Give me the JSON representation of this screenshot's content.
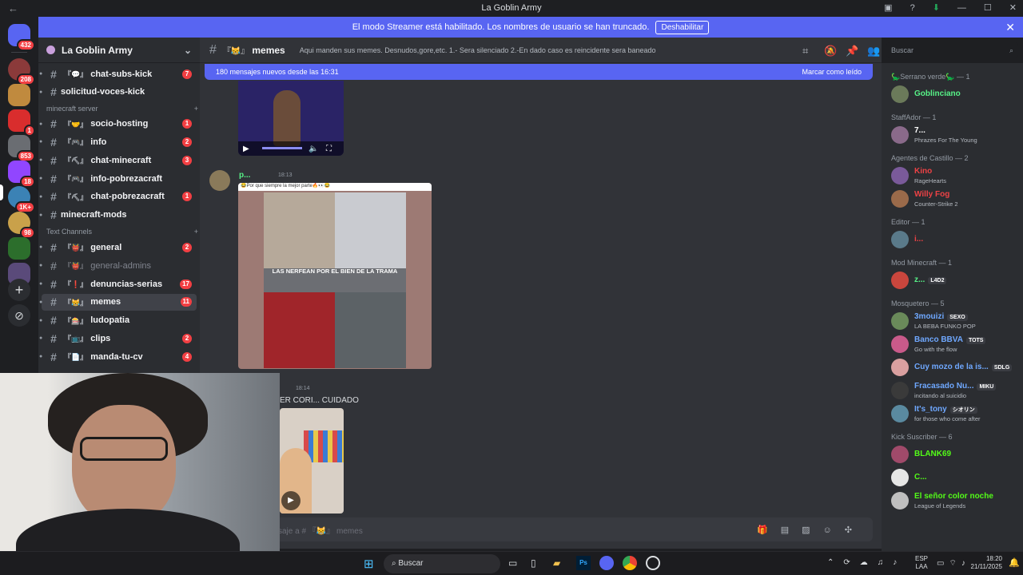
{
  "window": {
    "title": "La Goblin Army",
    "nav_back": "←",
    "nav_fwd": "→"
  },
  "streamer_banner": {
    "text": "El modo Streamer está habilitado. Los nombres de usuario se han truncado.",
    "button": "Deshabilitar"
  },
  "guild_badges": [
    "432",
    "208",
    "1",
    "853",
    "18",
    "1K+",
    "98"
  ],
  "server": {
    "name": "La Goblin Army"
  },
  "channels": {
    "top": [
      {
        "name": "chat-subs-kick",
        "emoji": "『💬』",
        "count": "7"
      },
      {
        "name": "solicitud-voces-kick",
        "emoji": "",
        "count": ""
      }
    ],
    "minecraft_category": "minecraft server",
    "minecraft": [
      {
        "name": "socio-hosting",
        "emoji": "『🤝』",
        "count": "1"
      },
      {
        "name": "info",
        "emoji": "『🎮』",
        "count": "2"
      },
      {
        "name": "chat-minecraft",
        "emoji": "『⛏』",
        "count": "3"
      },
      {
        "name": "info-pobrezacraft",
        "emoji": "『🎮』",
        "count": ""
      },
      {
        "name": "chat-pobrezacraft",
        "emoji": "『⛏』",
        "count": "1"
      },
      {
        "name": "minecraft-mods",
        "emoji": "",
        "count": ""
      }
    ],
    "text_category": "Text Channels",
    "text": [
      {
        "name": "general",
        "emoji": "『👹』",
        "count": "2"
      },
      {
        "name": "general-admins",
        "emoji": "『👹』",
        "count": ""
      },
      {
        "name": "denuncias-serias",
        "emoji": "『❗』",
        "count": "17"
      },
      {
        "name": "memes",
        "emoji": "『😹』",
        "count": "11"
      },
      {
        "name": "ludopatia",
        "emoji": "『🎰』",
        "count": ""
      },
      {
        "name": "clips",
        "emoji": "『📺』",
        "count": "2"
      },
      {
        "name": "manda-tu-cv",
        "emoji": "『📄』",
        "count": "4"
      }
    ]
  },
  "channel_header": {
    "name": "memes",
    "emoji": "『😹』",
    "topic": "Aqui manden sus memes. Desnudos,gore,etc. 1.- Sera silenciado 2.-En dado caso es reincidente sera baneado",
    "search_placeholder": "Buscar"
  },
  "new_messages": {
    "text": "180 mensajes nuevos desde las 16:31",
    "mark_read": "Marcar como leído"
  },
  "messages": [
    {
      "author": "p...",
      "time": "18:13",
      "image_caption": "😂Por que siempre la mejor parte🔥👀😂",
      "meme_text": "LAS NERFEAN POR EL BIEN DE LA TRAMA"
    },
    {
      "author": "",
      "time": "18:14",
      "text": "ER CORI... CUIDADO"
    }
  ],
  "composer": {
    "placeholder": "saje a # 『😹』 memes"
  },
  "members": [
    {
      "category": "🦕Serrano verde🦕 — 1",
      "users": [
        {
          "name": "Goblinciano",
          "status": "",
          "color": "#57f287",
          "tag": ""
        }
      ]
    },
    {
      "category": "StaffAdor — 1",
      "users": [
        {
          "name": "7...",
          "status": "Phrazes For The Young",
          "color": "#ffffff",
          "tag": ""
        }
      ]
    },
    {
      "category": "Agentes de Castillo — 2",
      "users": [
        {
          "name": "Kino",
          "status": "RageHearts",
          "color": "#ed4245",
          "tag": ""
        },
        {
          "name": "Willy Fog",
          "status": "Counter-Strike 2",
          "color": "#ed4245",
          "tag": ""
        }
      ]
    },
    {
      "category": "Editor — 1",
      "users": [
        {
          "name": "i...",
          "status": "",
          "color": "#ed4245",
          "tag": ""
        }
      ]
    },
    {
      "category": "Mod Minecraft — 1",
      "users": [
        {
          "name": "z...",
          "status": "",
          "color": "#57f287",
          "tag": "L4D2"
        }
      ]
    },
    {
      "category": "Mosquetero — 5",
      "users": [
        {
          "name": "3mouizi",
          "status": "LA BEBA FUNKO POP",
          "color": "#6fa8ff",
          "tag": "SEXO"
        },
        {
          "name": "Banco BBVA",
          "status": "Go with the flow",
          "color": "#6fa8ff",
          "tag": "TOTS"
        },
        {
          "name": "Cuy mozo de la is...",
          "status": "",
          "color": "#6fa8ff",
          "tag": "SDLG"
        },
        {
          "name": "Fracasado Nu...",
          "status": "incitando al suicidio",
          "color": "#6fa8ff",
          "tag": "MIKU"
        },
        {
          "name": "It's_tony",
          "status": "for those who come after",
          "color": "#6fa8ff",
          "tag": "シオリン"
        }
      ]
    },
    {
      "category": "Kick Suscriber — 6",
      "users": [
        {
          "name": "BLANK69",
          "status": "",
          "color": "#53fc18",
          "tag": ""
        },
        {
          "name": "C...",
          "status": "",
          "color": "#53fc18",
          "tag": ""
        },
        {
          "name": "El señor color noche",
          "status": "League of Legends",
          "color": "#53fc18",
          "tag": ""
        }
      ]
    }
  ],
  "taskbar": {
    "search": "Buscar",
    "lang": "ESP",
    "lang2": "LAA",
    "time": "18:20",
    "date": "21/11/2025"
  }
}
